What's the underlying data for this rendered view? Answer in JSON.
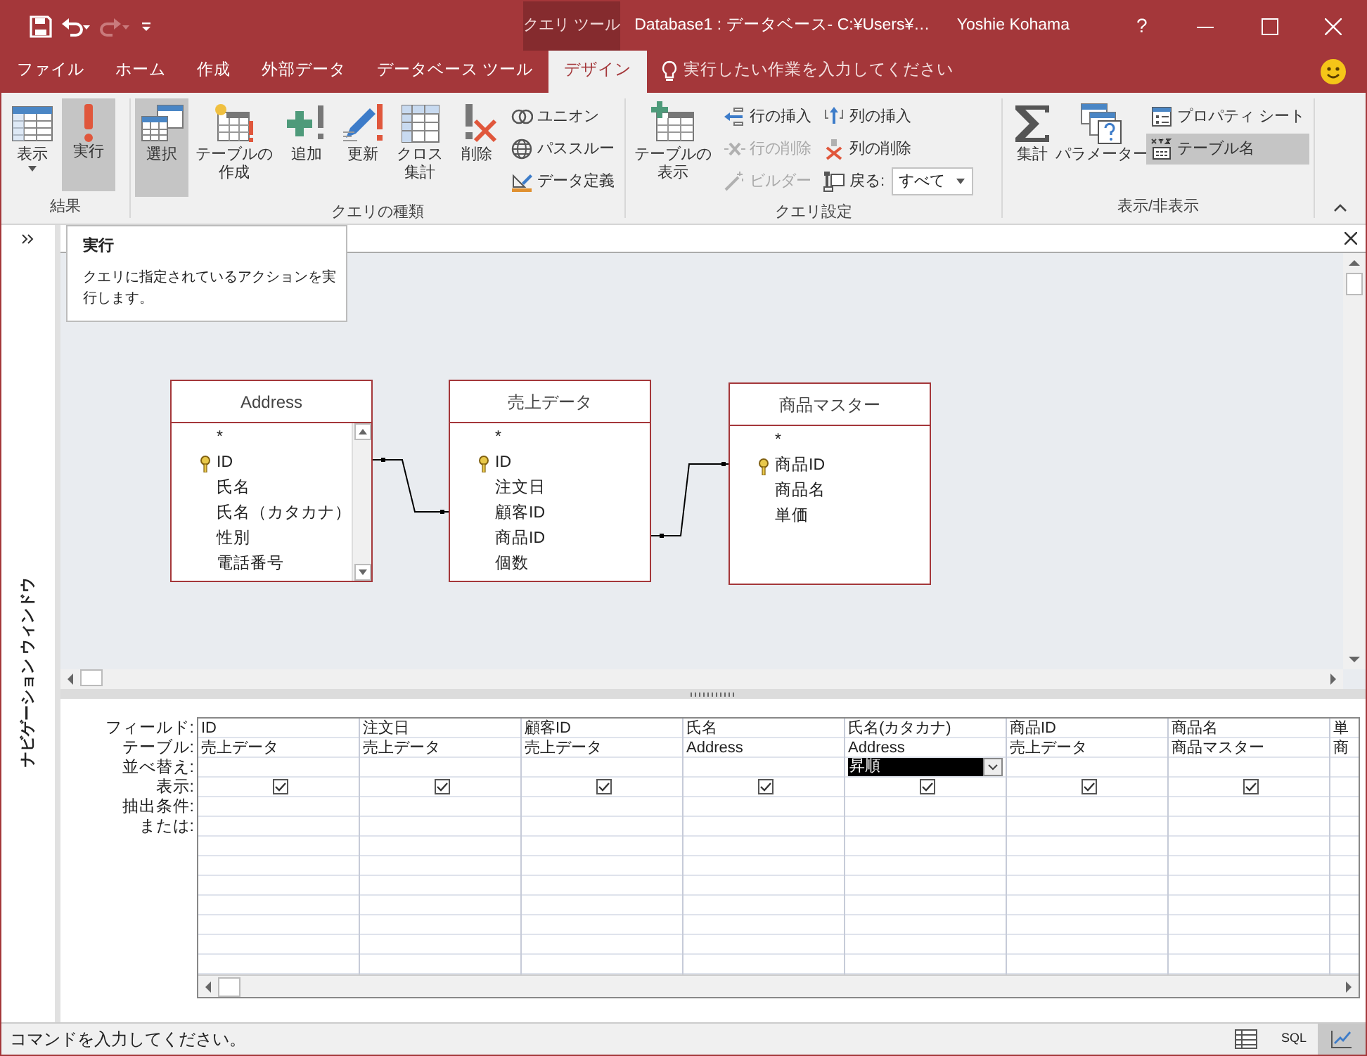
{
  "title_bar": {
    "context_tab": "クエリ ツール",
    "title": "Database1 : データベース- C:¥Users¥…",
    "user": "Yoshie Kohama",
    "help": "?"
  },
  "tabs": [
    {
      "label": "ファイル",
      "selected": false
    },
    {
      "label": "ホーム",
      "selected": false
    },
    {
      "label": "作成",
      "selected": false
    },
    {
      "label": "外部データ",
      "selected": false
    },
    {
      "label": "データベース ツール",
      "selected": false
    },
    {
      "label": "デザイン",
      "selected": true
    }
  ],
  "tell_me": {
    "placeholder": "実行したい作業を入力してください"
  },
  "ribbon": {
    "groups": [
      {
        "label": "結果",
        "columns": [
          {
            "kind": "large",
            "label": "表示",
            "dropdown": true,
            "highlighted": false,
            "disabled": false
          },
          {
            "kind": "large",
            "label": "実行",
            "dropdown": false,
            "highlighted": true,
            "disabled": false
          }
        ]
      },
      {
        "label": "クエリの種類",
        "columns": [
          {
            "kind": "large",
            "label": "選択",
            "dropdown": false,
            "highlighted": true,
            "disabled": false
          },
          {
            "kind": "large",
            "label": "テーブルの作成",
            "dropdown": false,
            "highlighted": false,
            "disabled": false
          },
          {
            "kind": "large",
            "label": "追加",
            "dropdown": false,
            "highlighted": false,
            "disabled": false
          },
          {
            "kind": "large",
            "label": "更新",
            "dropdown": false,
            "highlighted": false,
            "disabled": false
          },
          {
            "kind": "large",
            "label": "クロス集計",
            "dropdown": false,
            "highlighted": false,
            "disabled": false
          },
          {
            "kind": "large",
            "label": "削除",
            "dropdown": false,
            "highlighted": false,
            "disabled": false
          },
          {
            "kind": "stack",
            "items": [
              {
                "kind": "button",
                "label": "ユニオン",
                "highlighted": false,
                "disabled": false
              },
              {
                "kind": "button",
                "label": "パススルー",
                "highlighted": false,
                "disabled": false
              },
              {
                "kind": "button",
                "label": "データ定義",
                "highlighted": false,
                "disabled": false
              }
            ]
          }
        ]
      },
      {
        "label": "クエリ設定",
        "columns": [
          {
            "kind": "large",
            "label": "テーブルの表示",
            "dropdown": false,
            "highlighted": false,
            "disabled": false
          },
          {
            "kind": "stack",
            "items": [
              {
                "kind": "button",
                "label": "行の挿入",
                "highlighted": false,
                "disabled": false
              },
              {
                "kind": "button",
                "label": "行の削除",
                "highlighted": false,
                "disabled": true
              },
              {
                "kind": "button",
                "label": "ビルダー",
                "highlighted": false,
                "disabled": true
              }
            ]
          },
          {
            "kind": "stack",
            "items": [
              {
                "kind": "button",
                "label": "列の挿入",
                "highlighted": false,
                "disabled": false
              },
              {
                "kind": "button",
                "label": "列の削除",
                "highlighted": false,
                "disabled": false
              },
              {
                "kind": "combo",
                "label": "戻る:",
                "value": "すべて",
                "highlighted": false,
                "disabled": false
              }
            ]
          }
        ]
      },
      {
        "label": "表示/非表示",
        "columns": [
          {
            "kind": "large",
            "label": "集計",
            "dropdown": false,
            "highlighted": false,
            "disabled": false
          },
          {
            "kind": "large",
            "label": "パラメーター",
            "dropdown": false,
            "highlighted": false,
            "disabled": false
          },
          {
            "kind": "stack",
            "items": [
              {
                "kind": "button",
                "label": "プロパティ シート",
                "highlighted": false,
                "disabled": false
              },
              {
                "kind": "button",
                "label": "テーブル名",
                "highlighted": true,
                "disabled": false
              }
            ]
          }
        ]
      }
    ]
  },
  "tooltip": {
    "title": "実行",
    "text": "クエリに指定されているアクションを実行します。"
  },
  "navigation_pane": {
    "label": "ナビゲーション ウィンドウ"
  },
  "tables": [
    {
      "title": "Address",
      "scrollable": true,
      "fields": [
        {
          "name": "*",
          "primary_key": false
        },
        {
          "name": "ID",
          "primary_key": true
        },
        {
          "name": "氏名",
          "primary_key": false
        },
        {
          "name": "氏名（カタカナ）",
          "primary_key": false
        },
        {
          "name": "性別",
          "primary_key": false
        },
        {
          "name": "電話番号",
          "primary_key": false
        }
      ]
    },
    {
      "title": "売上データ",
      "scrollable": false,
      "fields": [
        {
          "name": "*",
          "primary_key": false
        },
        {
          "name": "ID",
          "primary_key": true
        },
        {
          "name": "注文日",
          "primary_key": false
        },
        {
          "name": "顧客ID",
          "primary_key": false
        },
        {
          "name": "商品ID",
          "primary_key": false
        },
        {
          "name": "個数",
          "primary_key": false
        }
      ]
    },
    {
      "title": "商品マスター",
      "scrollable": false,
      "fields": [
        {
          "name": "*",
          "primary_key": false
        },
        {
          "name": "商品ID",
          "primary_key": true
        },
        {
          "name": "商品名",
          "primary_key": false
        },
        {
          "name": "単価",
          "primary_key": false
        }
      ]
    }
  ],
  "grid": {
    "row_labels": [
      "フィールド:",
      "テーブル:",
      "並べ替え:",
      "表示:",
      "抽出条件:",
      "または:"
    ],
    "columns": [
      {
        "field": "ID",
        "table": "売上データ",
        "show": true,
        "focused": false
      },
      {
        "field": "注文日",
        "table": "売上データ",
        "show": true,
        "focused": false
      },
      {
        "field": "顧客ID",
        "table": "売上データ",
        "show": true,
        "focused": false
      },
      {
        "field": "氏名",
        "table": "Address",
        "show": true,
        "focused": false
      },
      {
        "field": "氏名(カタカナ)",
        "table": "Address",
        "sort": "昇順",
        "show": true,
        "focused": true
      },
      {
        "field": "商品ID",
        "table": "売上データ",
        "show": true,
        "focused": false
      },
      {
        "field": "商品名",
        "table": "商品マスター",
        "show": true,
        "focused": false
      },
      {
        "field": "単",
        "table": "商",
        "focused": false
      }
    ]
  },
  "status_bar": {
    "text": "コマンドを入力してください。",
    "views": [
      {
        "kind": "datasheet",
        "selected": false
      },
      {
        "kind": "sql",
        "label": "SQL",
        "selected": false
      },
      {
        "kind": "design",
        "selected": true
      }
    ]
  }
}
